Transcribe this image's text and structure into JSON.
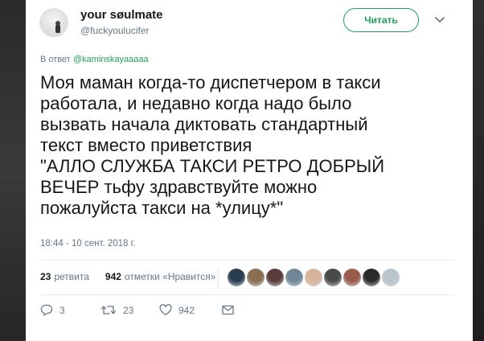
{
  "tweet": {
    "author_name": "your søulmate",
    "author_handle": "@fuckyoulucifer",
    "follow_label": "Читать",
    "reply_prefix": "В ответ",
    "reply_mention": "@kaminskayaaaaa",
    "text": "Моя маман когда-то диспетчером в такси\nработала, и недавно когда надо было\nвызвать начала диктовать стандартный\nтекст вместо приветствия\n\"АЛЛО СЛУЖБА ТАКСИ РЕТРО ДОБРЫЙ\nВЕЧЕР тьфу здравствуйте можно\nпожалуйста такси на *улицу*\"",
    "timestamp": "18:44 - 10 сент. 2018 г."
  },
  "stats": {
    "retweets_count": "23",
    "retweets_label": "ретвита",
    "likes_count": "942",
    "likes_label": "отметки «Нравится»"
  },
  "likers": [
    {
      "color": "#2b3e50"
    },
    {
      "color": "#8a6e4f"
    },
    {
      "color": "#5a3a3a"
    },
    {
      "color": "#6f8796"
    },
    {
      "color": "#d8b59a"
    },
    {
      "color": "#4a4a4a"
    },
    {
      "color": "#9a5b4d"
    },
    {
      "color": "#2a2a2a"
    },
    {
      "color": "#b9c4cc"
    }
  ],
  "actions": {
    "reply_count": "3",
    "retweet_count": "23",
    "like_count": "942",
    "icons": [
      "reply-icon",
      "retweet-icon",
      "like-icon",
      "message-icon"
    ]
  },
  "colors": {
    "accent": "#1da15b",
    "text": "#14171a",
    "muted": "#657786"
  }
}
